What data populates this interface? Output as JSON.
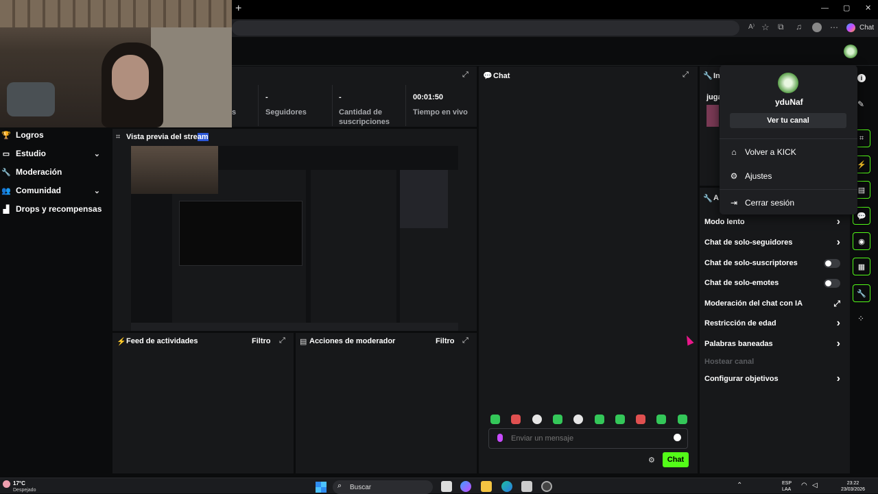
{
  "browser": {
    "new_tab": "+",
    "window_controls": [
      "—",
      "▢",
      "✕"
    ],
    "toolbar_icons": [
      "read-aloud-icon",
      "favorite-star-icon",
      "extensions-icon",
      "collections-icon",
      "profile-icon",
      "more-icon"
    ],
    "copilot_label": "Chat"
  },
  "nav": {
    "items": [
      {
        "label": "Logros",
        "icon": "trophy-icon",
        "expandable": false
      },
      {
        "label": "Estudio",
        "icon": "studio-icon",
        "expandable": true
      },
      {
        "label": "Moderación",
        "icon": "wrench-icon",
        "expandable": false
      },
      {
        "label": "Comunidad",
        "icon": "community-icon",
        "expandable": true
      },
      {
        "label": "Drops y recompensas",
        "icon": "drops-icon",
        "expandable": false
      }
    ]
  },
  "stats": [
    {
      "value": "",
      "label": "s"
    },
    {
      "value": "-",
      "label": "Seguidores"
    },
    {
      "value": "-",
      "label": "Cantidad de suscripciones"
    },
    {
      "value": "00:01:50",
      "label": "Tiempo en vivo"
    }
  ],
  "preview": {
    "title_a": "Vista previa del stre",
    "title_b": "am"
  },
  "activity": {
    "title": "Feed de actividades",
    "filter": "Filtro"
  },
  "modactions": {
    "title": "Acciones de moderador",
    "filter": "Filtro"
  },
  "chat": {
    "title": "Chat",
    "placeholder": "Enviar un mensaje",
    "send_label": "Chat",
    "emote_count": 10
  },
  "info": {
    "title": "In",
    "text": "juga"
  },
  "modsettings": {
    "title": "A",
    "rows": [
      {
        "label": "Modo lento",
        "control": "arrow"
      },
      {
        "label": "Chat de solo-seguidores",
        "control": "arrow"
      },
      {
        "label": "Chat de solo-suscriptores",
        "control": "toggle"
      },
      {
        "label": "Chat de solo-emotes",
        "control": "toggle"
      },
      {
        "label": "Moderación del chat con IA",
        "control": "external"
      },
      {
        "label": "Restricción de edad",
        "control": "arrow"
      },
      {
        "label": "Palabras baneadas",
        "control": "arrow"
      },
      {
        "label": "Hostear canal",
        "control": "none",
        "disabled": true
      },
      {
        "label": "Configurar objetivos",
        "control": "arrow"
      }
    ]
  },
  "dropdown": {
    "username": "yduNaf",
    "view_channel": "Ver tu canal",
    "items": [
      {
        "label": "Volver a KICK",
        "icon": "home-icon"
      },
      {
        "label": "Ajustes",
        "icon": "gear-icon"
      },
      {
        "label": "Cerrar sesión",
        "icon": "logout-icon"
      }
    ]
  },
  "taskbar": {
    "weather_temp": "17°C",
    "weather_desc": "Despejado",
    "search": "Buscar",
    "lang_a": "ESP",
    "lang_b": "LAA",
    "time": "23:22",
    "date": "23/03/2026"
  },
  "colors": {
    "accent": "#53fc18",
    "panel": "#17181a",
    "bg": "#0b0c0d"
  }
}
